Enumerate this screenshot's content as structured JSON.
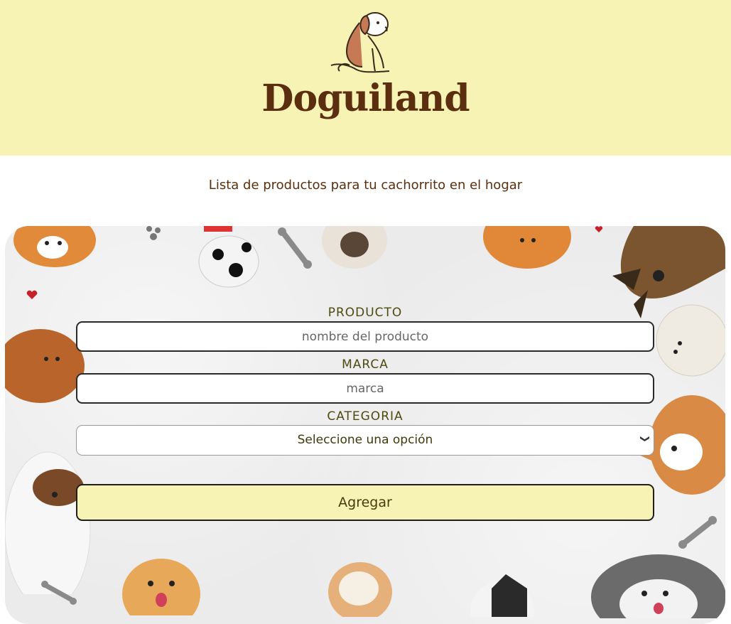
{
  "header": {
    "brand": "Doguiland",
    "logo_icon": "sitting-dog-logo",
    "background": "#f7f3b5"
  },
  "tagline": "Lista de productos para tu cachorrito en el hogar",
  "form": {
    "producto": {
      "label": "PRODUCTO",
      "placeholder": "nombre del producto",
      "value": ""
    },
    "marca": {
      "label": "MARCA",
      "placeholder": "marca",
      "value": ""
    },
    "categoria": {
      "label": "CATEGORIA",
      "selected": "Seleccione una opción",
      "icon": "chevron-down-icon"
    },
    "submit_label": "Agregar"
  },
  "colors": {
    "accent": "#f7f3b5",
    "brand_text": "#5a2e0e",
    "panel": "#ebebeb"
  }
}
